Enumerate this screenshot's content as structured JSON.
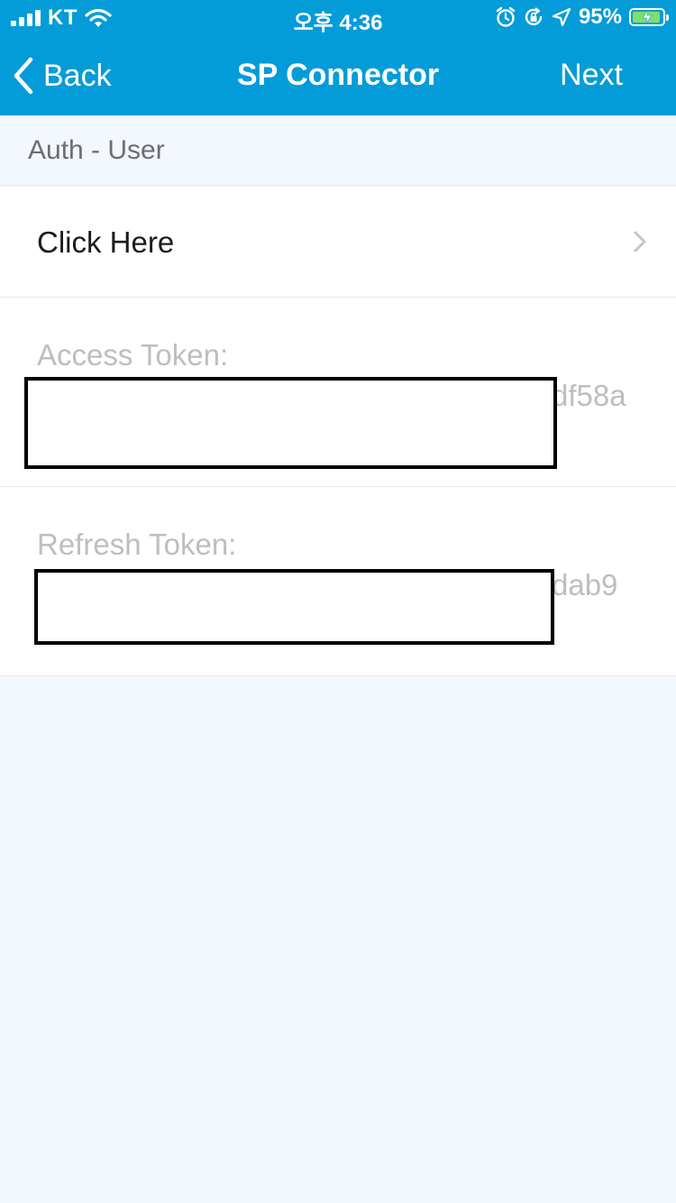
{
  "status_bar": {
    "carrier": "KT",
    "time": "오후 4:36",
    "battery_percent": "95%",
    "battery_level": 0.95,
    "icons": [
      "signal-icon",
      "wifi-icon",
      "alarm-icon",
      "rotation-lock-icon",
      "location-arrow-icon",
      "battery-charging-icon"
    ]
  },
  "nav": {
    "back_label": "Back",
    "title": "SP Connector",
    "next_label": "Next"
  },
  "section": {
    "header": "Auth - User"
  },
  "rows": {
    "click_here": "Click Here",
    "access_token_label": "Access Token:",
    "access_token_suffix": "df58a",
    "refresh_token_label": "Refresh Token:",
    "refresh_token_suffix": "dab9"
  },
  "colors": {
    "nav_background": "#039cd8",
    "page_background": "#f3f7fe",
    "cell_background": "#ffffff",
    "placeholder_text": "#bdbdc2",
    "battery_fill": "#7ee06a"
  }
}
